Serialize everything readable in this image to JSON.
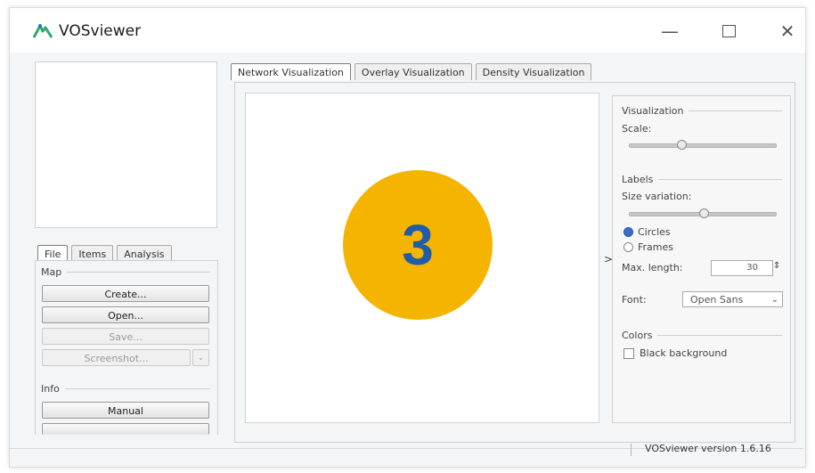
{
  "window": {
    "title": "VOSviewer",
    "logo_icon": "vosviewer-logo-icon",
    "controls": {
      "minimize": "—",
      "maximize": "□",
      "close": "✕"
    }
  },
  "left_tabs": {
    "file": "File",
    "items": "Items",
    "analysis": "Analysis",
    "active": "File"
  },
  "left": {
    "map_group": "Map",
    "create": "Create...",
    "open": "Open...",
    "save": "Save...",
    "screenshot": "Screenshot...",
    "info_group": "Info",
    "manual": "Manual"
  },
  "main_tabs": {
    "network": "Network Visualization",
    "overlay": "Overlay Visualization",
    "density": "Density Visualization",
    "active": "Network Visualization"
  },
  "overlay_badge": {
    "number": "3",
    "color": "#f4b400",
    "text_color": "#1e5ea8"
  },
  "collapse_arrow": ">",
  "right_panel": {
    "visualization_group": "Visualization",
    "scale_label": "Scale:",
    "scale_value": 0.35,
    "labels_group": "Labels",
    "size_variation_label": "Size variation:",
    "size_variation_value": 0.5,
    "circles": "Circles",
    "frames": "Frames",
    "selected_shape": "Circles",
    "max_length_label": "Max. length:",
    "max_length_value": "30",
    "font_label": "Font:",
    "font_value": "Open Sans",
    "colors_group": "Colors",
    "black_background": "Black background",
    "black_background_checked": false
  },
  "status": {
    "version": "VOSviewer version 1.6.16"
  }
}
